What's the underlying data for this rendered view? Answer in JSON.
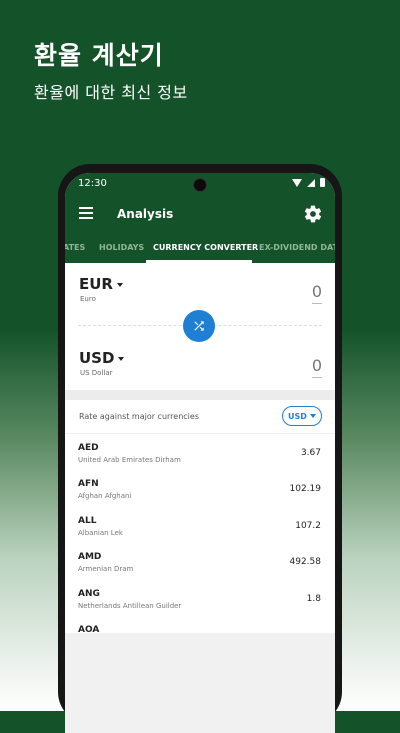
{
  "promo": {
    "title": "환율 계산기",
    "subtitle": "환율에 대한 최신 정보"
  },
  "status_bar": {
    "time": "12:30"
  },
  "toolbar": {
    "title": "Analysis"
  },
  "tabs": [
    {
      "label": "ATES"
    },
    {
      "label": "HOLIDAYS"
    },
    {
      "label": "CURRENCY CONVERTER",
      "active": true
    },
    {
      "label": "EX-DIVIDEND DATES"
    }
  ],
  "converter": {
    "from": {
      "code": "EUR",
      "name": "Euro",
      "amount": "0"
    },
    "to": {
      "code": "USD",
      "name": "US Dollar",
      "amount": "0"
    }
  },
  "rates": {
    "label": "Rate against major currencies",
    "base": "USD",
    "items": [
      {
        "code": "AED",
        "name": "United Arab Emirates Dirham",
        "value": "3.67"
      },
      {
        "code": "AFN",
        "name": "Afghan Afghani",
        "value": "102.19"
      },
      {
        "code": "ALL",
        "name": "Albanian Lek",
        "value": "107.2"
      },
      {
        "code": "AMD",
        "name": "Armenian Dram",
        "value": "492.58"
      },
      {
        "code": "ANG",
        "name": "Netherlands Antillean Guilder",
        "value": "1.8"
      },
      {
        "code": "AOA",
        "name": "",
        "value": ""
      }
    ]
  },
  "colors": {
    "primary": "#14532a",
    "accent": "#1e7fd3"
  }
}
